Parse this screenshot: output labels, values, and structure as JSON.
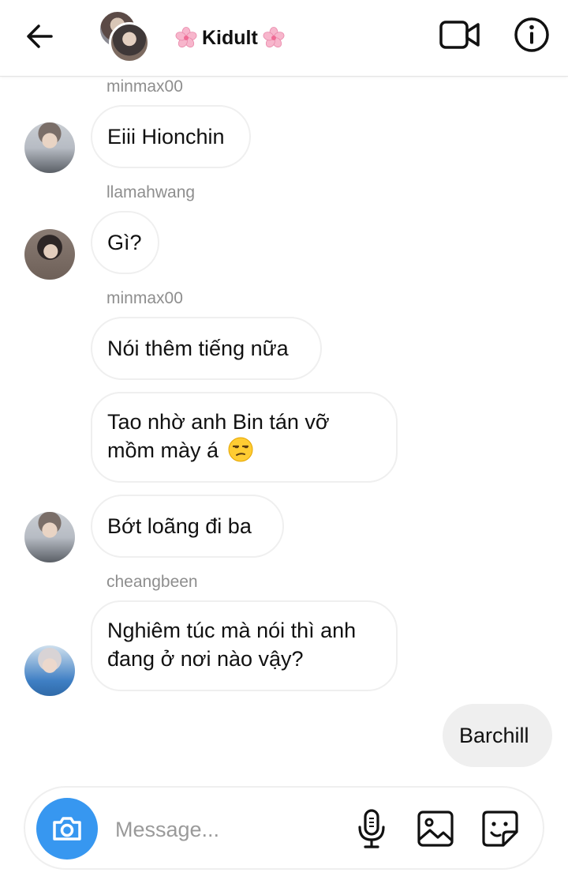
{
  "header": {
    "title": "Kidult",
    "flower_emoji": "🌸"
  },
  "messages": [
    {
      "sender": "minmax00",
      "text": "Eiii Hionchin"
    },
    {
      "sender": "llamahwang",
      "text": "Gì?"
    },
    {
      "sender": "minmax00",
      "text": "Nói thêm tiếng nữa"
    },
    {
      "line1": "Tao nhờ anh Bin tán vỡ",
      "line2": "mồm mày á",
      "emoji": "😒"
    },
    {
      "text": "Bớt loãng đi ba"
    },
    {
      "sender": "cheangbeen",
      "line1": "Nghiêm túc mà nói thì anh",
      "line2": "đang ở nơi nào vậy?"
    },
    {
      "text": "Barchill",
      "mine": true
    }
  ],
  "composer": {
    "placeholder": "Message..."
  },
  "colors": {
    "accent": "#3797f0",
    "bubble_border": "#efefef",
    "sender_text": "#8e8e8e",
    "own_bubble": "#efefef"
  },
  "icons": [
    "back-arrow-icon",
    "video-call-icon",
    "info-icon",
    "camera-icon",
    "microphone-icon",
    "gallery-icon",
    "sticker-icon"
  ]
}
